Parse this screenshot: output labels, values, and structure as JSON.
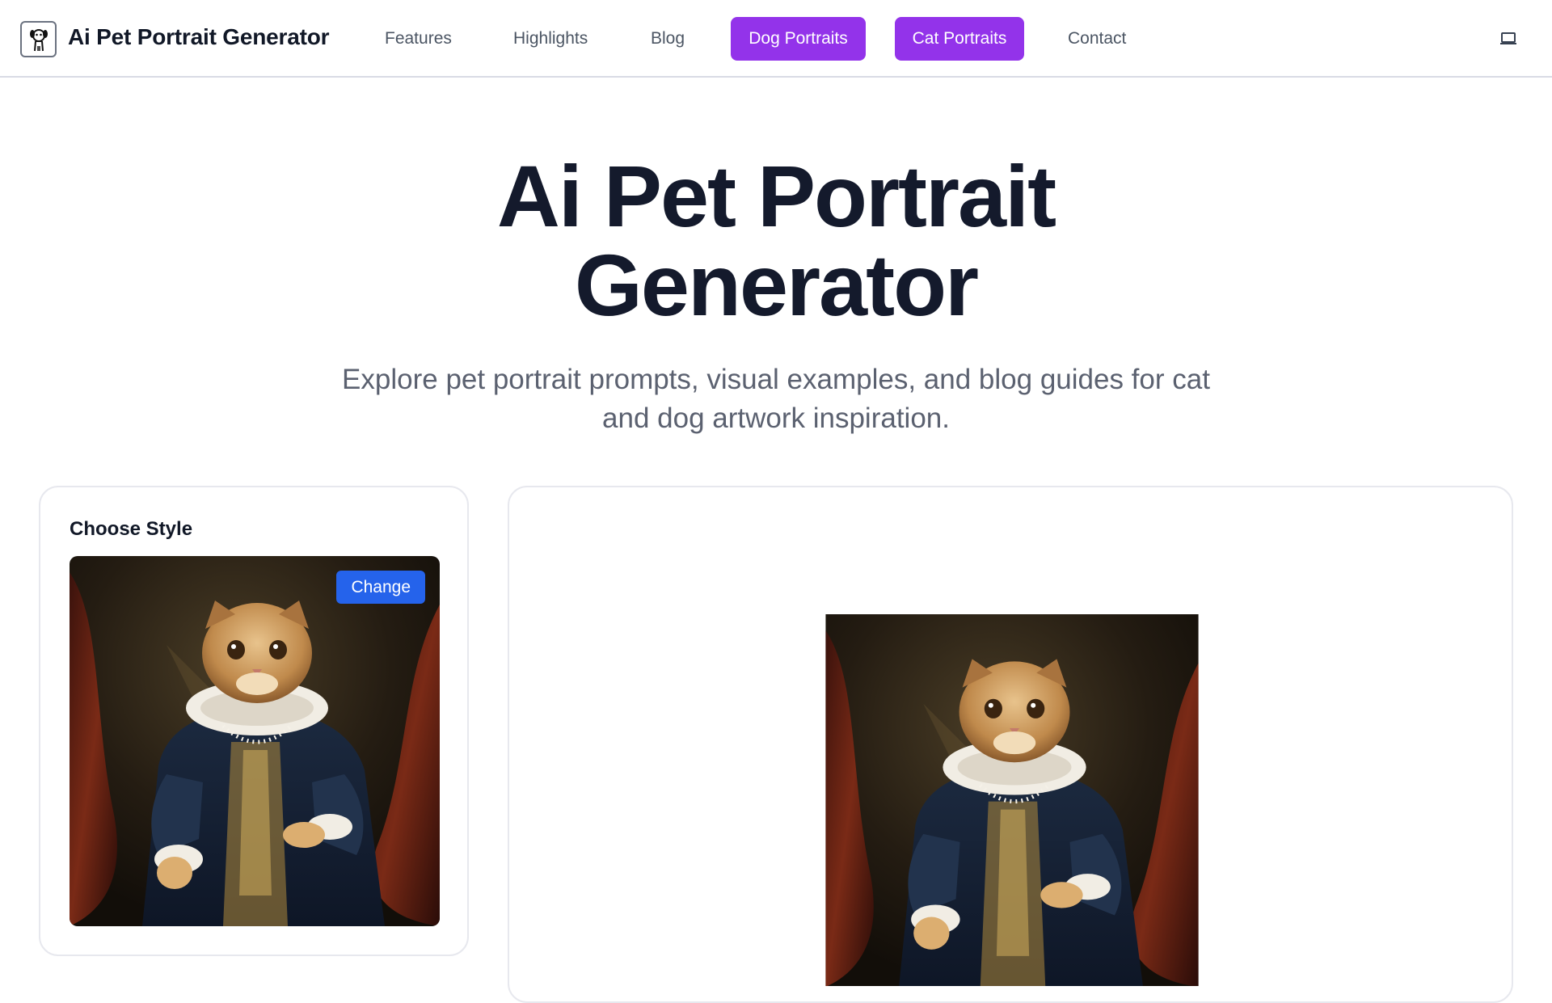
{
  "header": {
    "brand": "Ai Pet Portrait Generator",
    "nav": {
      "features": "Features",
      "highlights": "Highlights",
      "blog": "Blog",
      "dog_portraits": "Dog Portraits",
      "cat_portraits": "Cat Portraits",
      "contact": "Contact"
    },
    "logo_icon": "dog-logo-icon",
    "theme_icon": "laptop-icon"
  },
  "hero": {
    "title_line1": "Ai Pet Portrait",
    "title_line2": "Generator",
    "subtitle_line1": "Explore pet portrait prompts, visual examples, and blog guides for cat",
    "subtitle_line2": "and dog artwork inspiration."
  },
  "style_panel": {
    "title": "Choose Style",
    "change_label": "Change",
    "selected_image": "cat-renaissance-portrait"
  },
  "preview_panel": {
    "image": "cat-renaissance-portrait"
  },
  "colors": {
    "accent_purple": "#9333ea",
    "button_blue": "#2563eb",
    "title_dark": "#141a2c",
    "muted_text": "#5b6170"
  }
}
